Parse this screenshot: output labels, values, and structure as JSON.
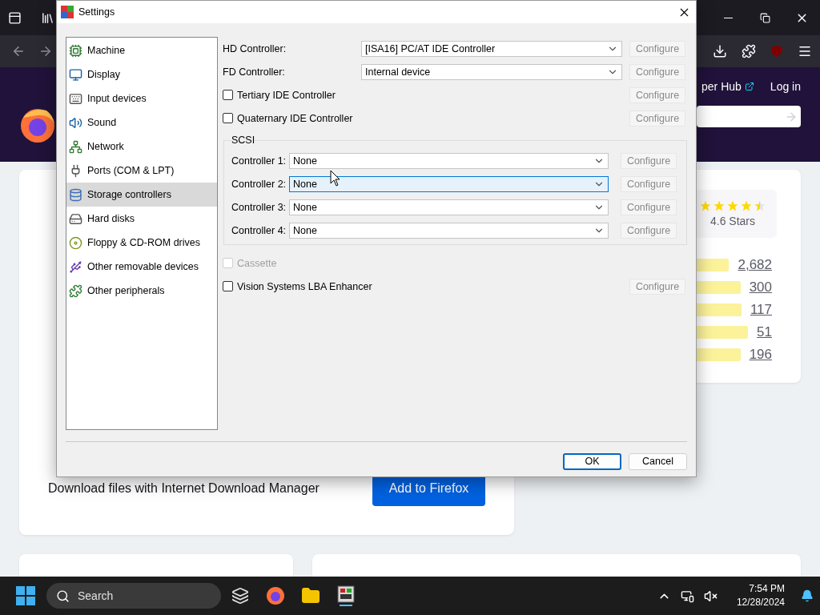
{
  "browser": {
    "header": {
      "partial_link": "per Hub",
      "login": "Log in"
    },
    "rating": {
      "stars": 4.5,
      "label": "4.6 Stars",
      "bars": [
        {
          "count": "2,682",
          "level": 1.0
        },
        {
          "count": "300",
          "level": 1.0
        },
        {
          "count": "117",
          "level": 1.0
        },
        {
          "count": "51",
          "level": 1.0
        },
        {
          "count": "196",
          "level": 1.0
        }
      ]
    },
    "promo": {
      "text": "Download files with Internet Download Manager",
      "button": "Add to Firefox"
    }
  },
  "dialog": {
    "title": "Settings",
    "categories": [
      {
        "label": "Machine",
        "selected": false
      },
      {
        "label": "Display",
        "selected": false
      },
      {
        "label": "Input devices",
        "selected": false
      },
      {
        "label": "Sound",
        "selected": false
      },
      {
        "label": "Network",
        "selected": false
      },
      {
        "label": "Ports (COM & LPT)",
        "selected": false
      },
      {
        "label": "Storage controllers",
        "selected": true
      },
      {
        "label": "Hard disks",
        "selected": false
      },
      {
        "label": "Floppy & CD-ROM drives",
        "selected": false
      },
      {
        "label": "Other removable devices",
        "selected": false
      },
      {
        "label": "Other peripherals",
        "selected": false
      }
    ],
    "controllers": [
      {
        "kind": "select",
        "label": "HD Controller:",
        "value": "[ISA16] PC/AT IDE Controller",
        "configure": "Configure"
      },
      {
        "kind": "select",
        "label": "FD Controller:",
        "value": "Internal device",
        "configure": "Configure"
      },
      {
        "kind": "checkbox",
        "label": "Tertiary IDE Controller",
        "checked": false,
        "configure": "Configure"
      },
      {
        "kind": "checkbox",
        "label": "Quaternary IDE Controller",
        "checked": false,
        "configure": "Configure"
      }
    ],
    "scsi": {
      "title": "SCSI",
      "controllers": [
        {
          "label": "Controller 1:",
          "value": "None",
          "hovered": false,
          "configure": "Configure"
        },
        {
          "label": "Controller 2:",
          "value": "None",
          "hovered": true,
          "configure": "Configure"
        },
        {
          "label": "Controller 3:",
          "value": "None",
          "hovered": false,
          "configure": "Configure"
        },
        {
          "label": "Controller 4:",
          "value": "None",
          "hovered": false,
          "configure": "Configure"
        }
      ]
    },
    "cassette": {
      "label": "Cassette",
      "checked": false,
      "disabled": true
    },
    "lba": {
      "label": "Vision Systems LBA Enhancer",
      "checked": false,
      "configure": "Configure"
    },
    "buttons": [
      {
        "label": "OK",
        "default": true
      },
      {
        "label": "Cancel",
        "default": false
      }
    ]
  },
  "taskbar": {
    "search_placeholder": "Search",
    "time": "7:54 PM",
    "date": "12/28/2024"
  }
}
